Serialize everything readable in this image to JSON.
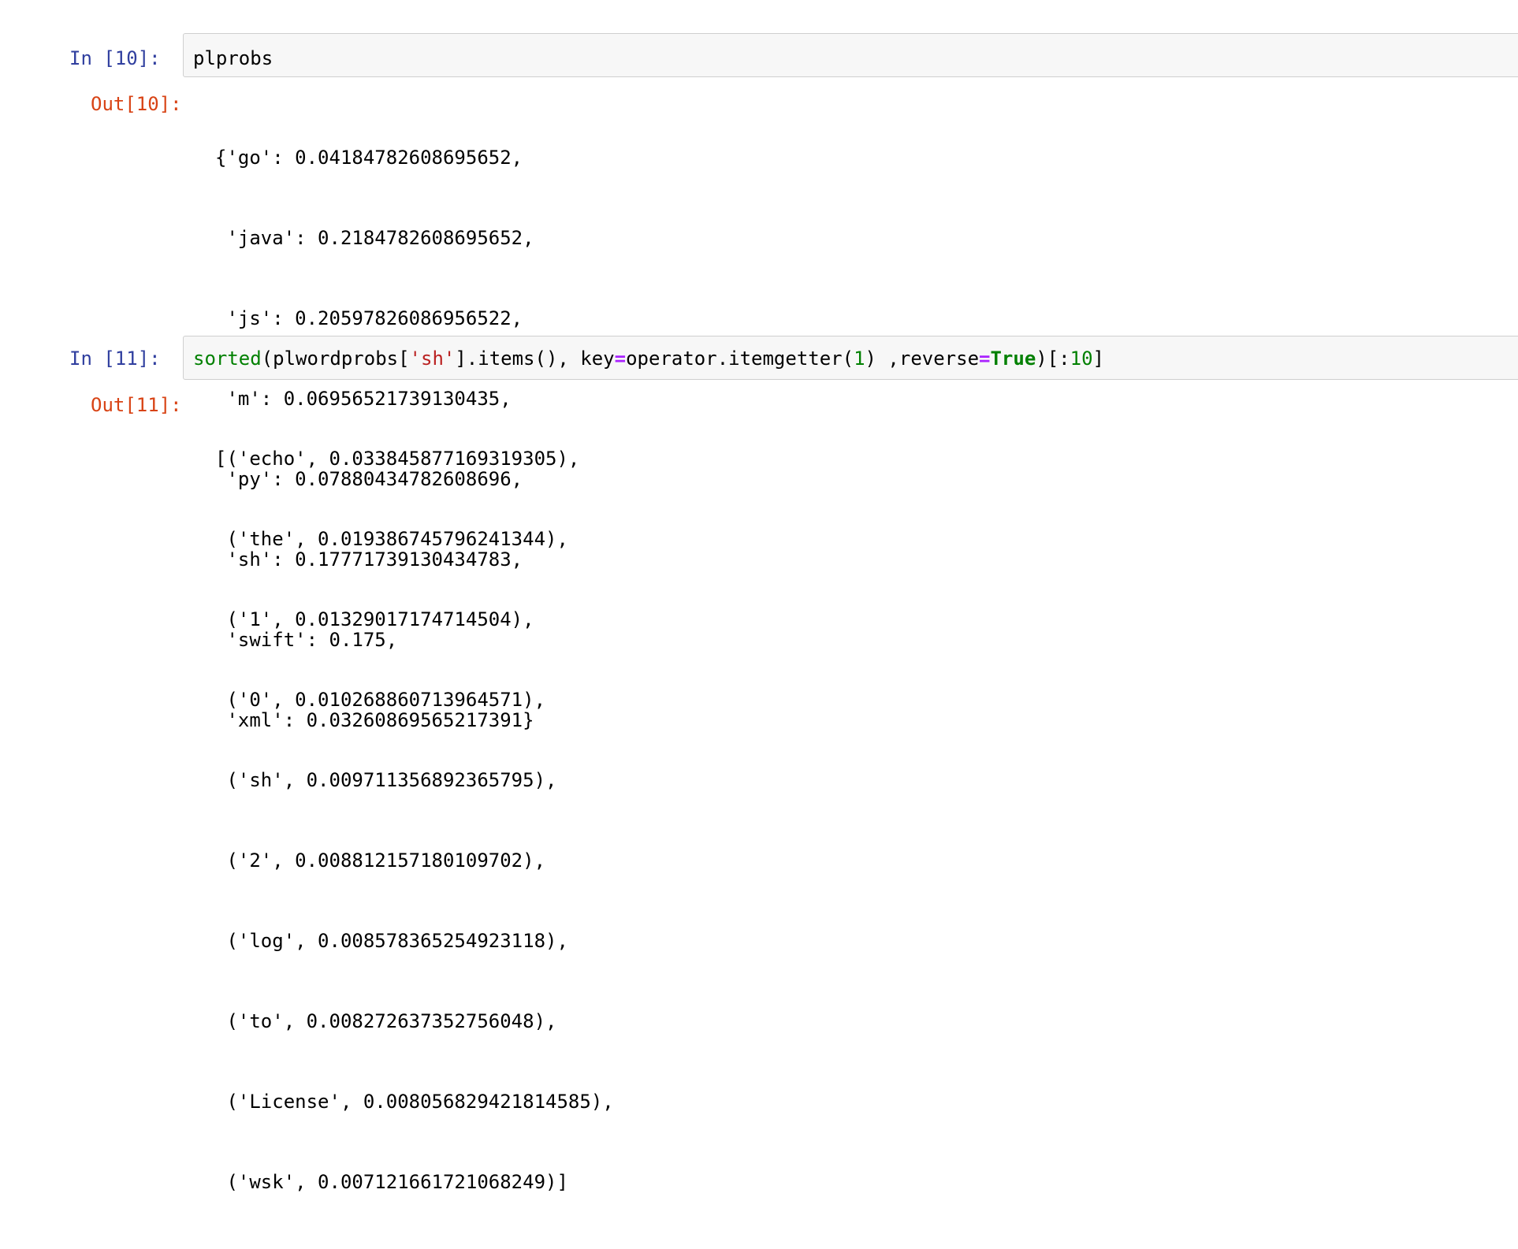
{
  "cells": [
    {
      "in_prompt": "In [10]:",
      "input_tokens": [
        {
          "type": "plain",
          "text": "plprobs"
        }
      ],
      "out_prompt": "Out[10]:",
      "output_lines": [
        "{'go': 0.04184782608695652,",
        " 'java': 0.2184782608695652,",
        " 'js': 0.20597826086956522,",
        " 'm': 0.06956521739130435,",
        " 'py': 0.07880434782608696,",
        " 'sh': 0.17771739130434783,",
        " 'swift': 0.175,",
        " 'xml': 0.03260869565217391}"
      ]
    },
    {
      "in_prompt": "In [11]:",
      "input_tokens": [
        {
          "type": "builtin",
          "text": "sorted"
        },
        {
          "type": "plain",
          "text": "(plwordprobs["
        },
        {
          "type": "string",
          "text": "'sh'"
        },
        {
          "type": "plain",
          "text": "].items(), key"
        },
        {
          "type": "op",
          "text": "="
        },
        {
          "type": "plain",
          "text": "operator.itemgetter("
        },
        {
          "type": "num",
          "text": "1"
        },
        {
          "type": "plain",
          "text": ") ,reverse"
        },
        {
          "type": "op",
          "text": "="
        },
        {
          "type": "kw",
          "text": "True"
        },
        {
          "type": "plain",
          "text": ")[:"
        },
        {
          "type": "num",
          "text": "10"
        },
        {
          "type": "plain",
          "text": "]"
        }
      ],
      "out_prompt": "Out[11]:",
      "output_lines": [
        "[('echo', 0.033845877169319305),",
        " ('the', 0.019386745796241344),",
        " ('1', 0.01329017174714504),",
        " ('0', 0.010268860713964571),",
        " ('sh', 0.009711356892365795),",
        " ('2', 0.008812157180109702),",
        " ('log', 0.008578365254923118),",
        " ('to', 0.008272637352756048),",
        " ('License', 0.008056829421814585),",
        " ('wsk', 0.007121661721068249)]"
      ]
    }
  ],
  "colors": {
    "in_prompt": "#303f9f",
    "out_prompt": "#d84315",
    "input_bg": "#f7f7f7",
    "input_border": "#cfcfcf",
    "builtin": "#008000",
    "string": "#ba2121",
    "operator": "#aa22ff",
    "number": "#008000",
    "keyword": "#008000"
  }
}
